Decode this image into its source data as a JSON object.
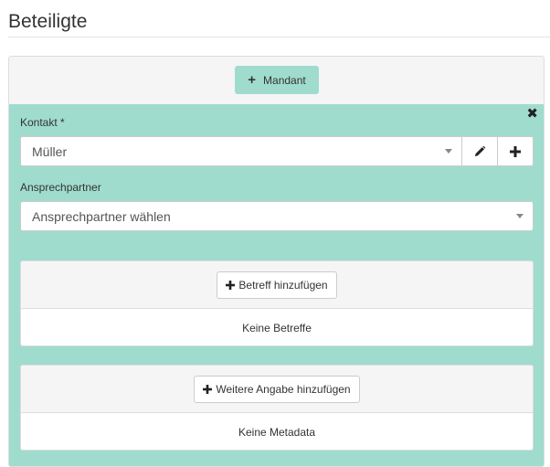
{
  "page": {
    "title": "Beteiligte"
  },
  "mandant_button": {
    "label": "Mandant",
    "icon": "plus-icon"
  },
  "party": {
    "remove_icon": "close-icon",
    "kontakt": {
      "label": "Kontakt *",
      "value": "Müller",
      "edit_icon": "pencil-icon",
      "add_icon": "plus-icon"
    },
    "ansprechpartner": {
      "label": "Ansprechpartner",
      "placeholder": "Ansprechpartner wählen"
    },
    "betreff": {
      "button_label": "Betreff hinzufügen",
      "empty_text": "Keine Betreffe"
    },
    "metadata": {
      "button_label": "Weitere Angabe hinzufügen",
      "empty_text": "Keine Metadata"
    }
  },
  "colors": {
    "accent": "#a0dccd",
    "panel_bg": "#f5f5f5",
    "border": "#cccccc"
  }
}
